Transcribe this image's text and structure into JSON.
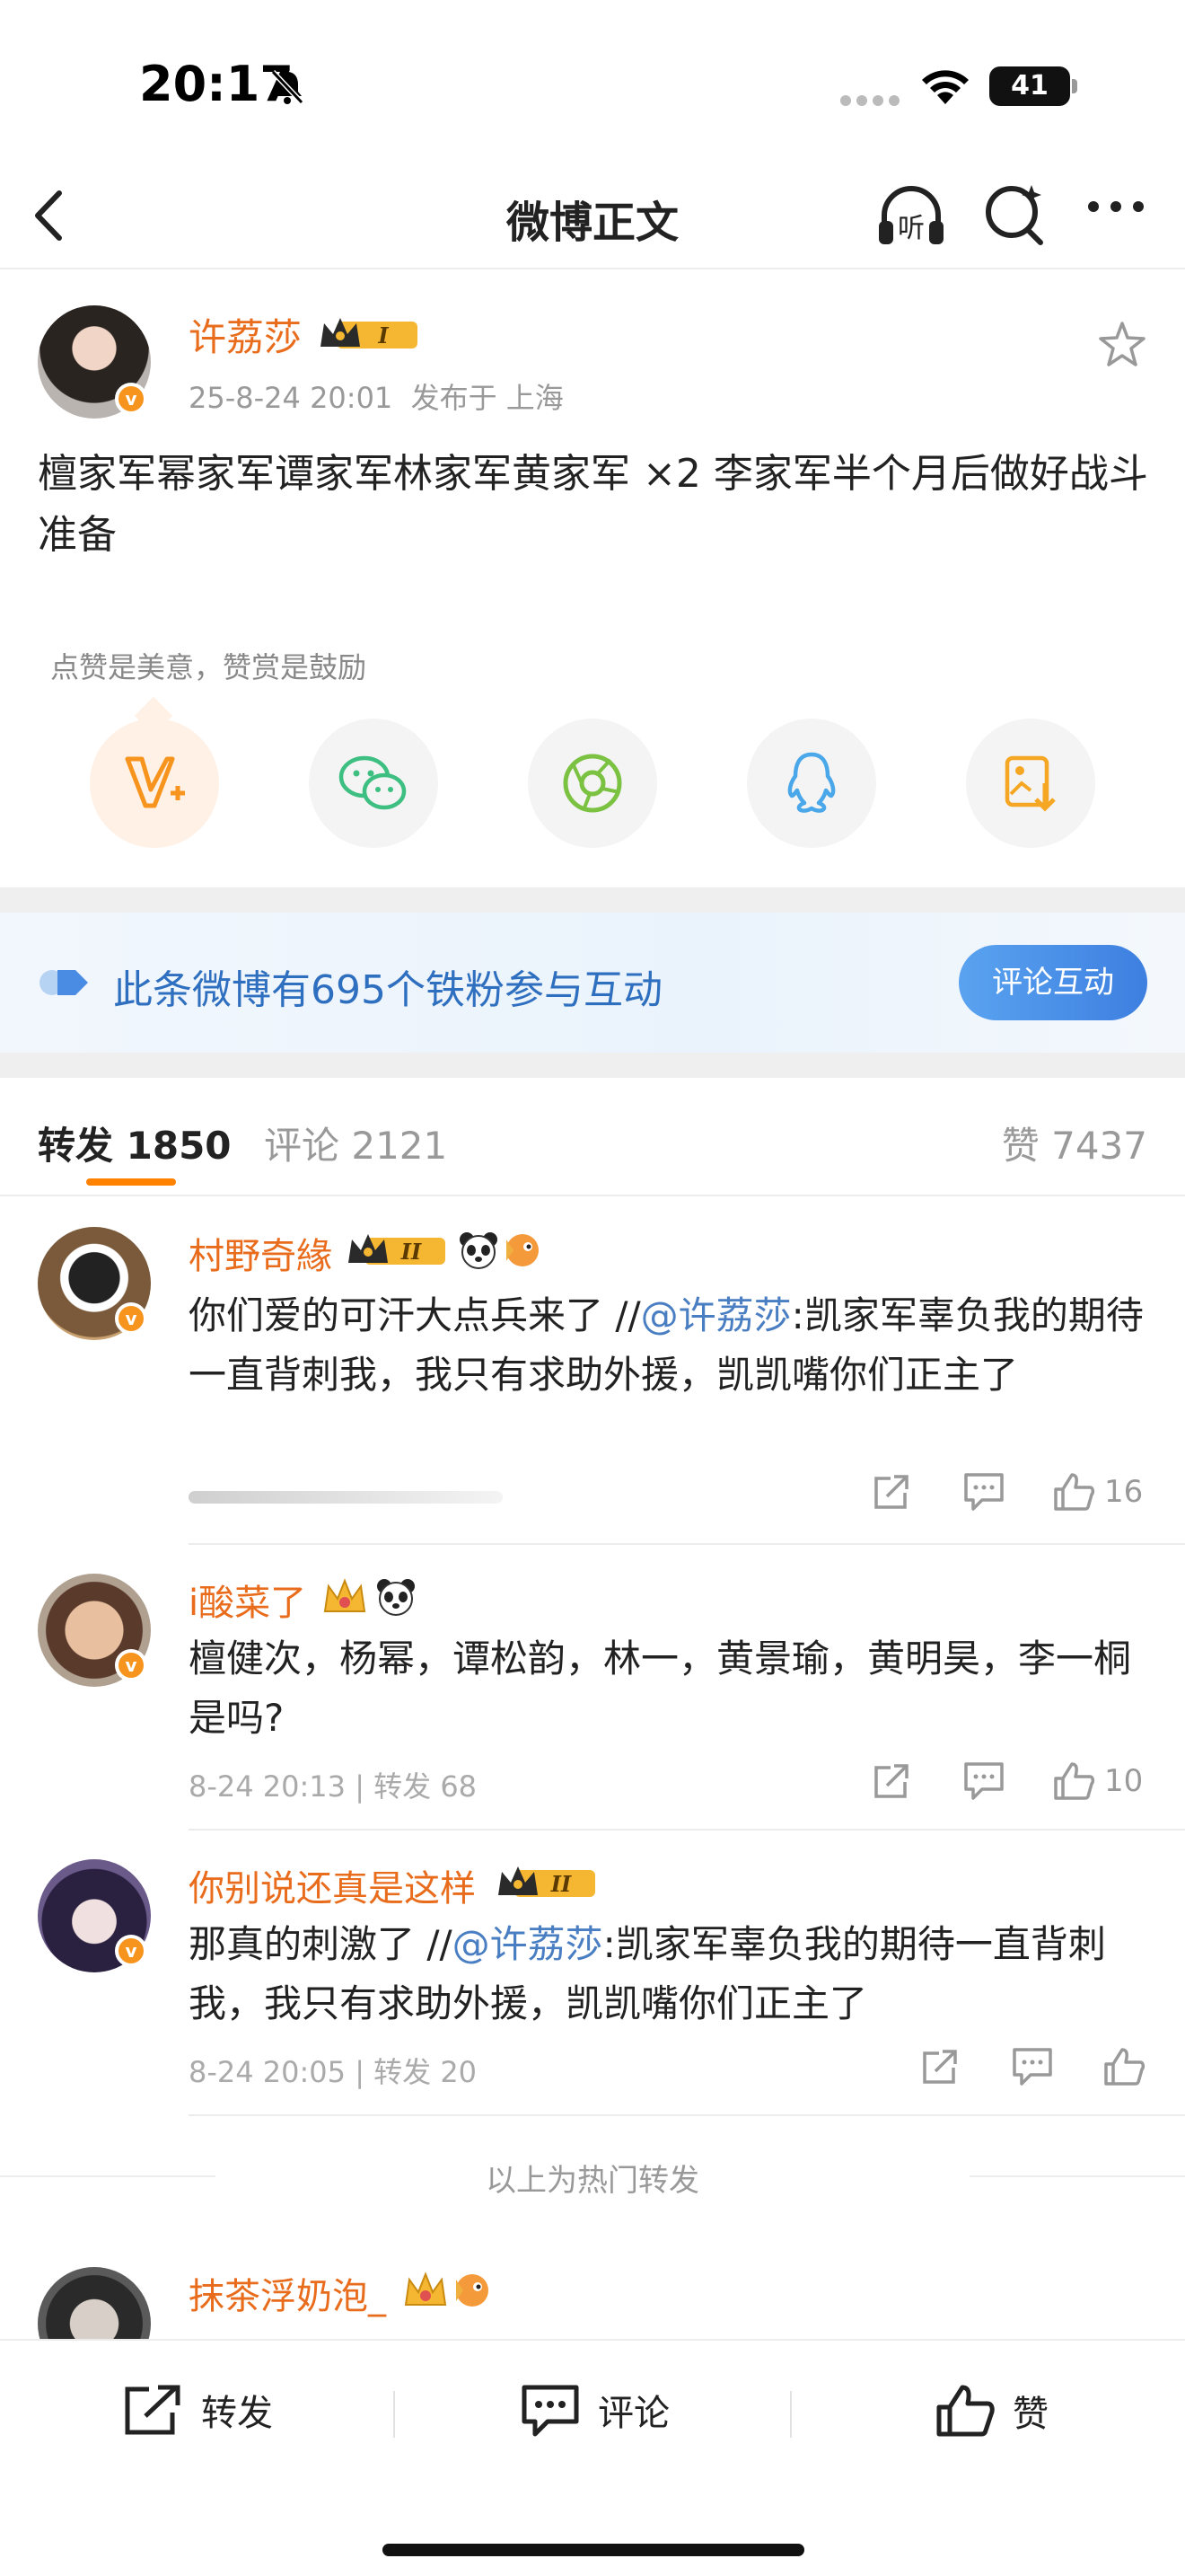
{
  "status_bar": {
    "time": "20:17",
    "battery": "41"
  },
  "nav": {
    "title": "微博正文",
    "back_icon": "chevron-left-icon",
    "listen_label": "听"
  },
  "post": {
    "author": "许荔莎",
    "level": "I",
    "date": "25-8-24 20:01",
    "location": "发布于 上海",
    "text": "檀家军幂家军谭家军林家军黄家军 ×2 李家军半个月后做好战斗准备",
    "reward_tip": "点赞是美意，赞赏是鼓励"
  },
  "share_targets": [
    "reward-v-icon",
    "wechat-icon",
    "moments-icon",
    "qq-icon",
    "save-image-icon"
  ],
  "fans_banner": {
    "text": "此条微博有695个铁粉参与互动",
    "button": "评论互动"
  },
  "tabs": {
    "repost": "转发 1850",
    "comment": "评论 2121",
    "like": "赞 7437"
  },
  "reposts": [
    {
      "name": "村野奇緣",
      "level": "II",
      "text_pre": "你们爱的可汗大点兵来了 //",
      "mention": "@许荔莎",
      "text_post": ":凯家军辜负我的期待一直背刺我，我只有求助外援，凯凯嘴你们正主了",
      "meta": "",
      "likes": "16"
    },
    {
      "name": "i酸菜了",
      "level": "",
      "text_pre": "檀健次，杨幂，谭松韵，林一，黄景瑜，黄明昊，李一桐是吗?",
      "mention": "",
      "text_post": "",
      "meta": "8-24 20:13 | 转发 68",
      "likes": "10"
    },
    {
      "name": "你别说还真是这样",
      "level": "II",
      "text_pre": "那真的刺激了 //",
      "mention": "@许荔莎",
      "text_post": ":凯家军辜负我的期待一直背刺我，我只有求助外援，凯凯嘴你们正主了",
      "meta": "8-24 20:05 | 转发 20",
      "likes": ""
    },
    {
      "name": "抹茶浮奶泡_",
      "level": "",
      "text_pre": "",
      "mention": "",
      "text_post": "",
      "meta": "",
      "likes": ""
    }
  ],
  "hot_end": "以上为热门转发",
  "bottom_bar": {
    "repost": "转发",
    "comment": "评论",
    "like": "赞"
  },
  "colors": {
    "accent": "#ff8200",
    "name": "#e86c1c",
    "link": "#4a7ec2",
    "button": "#3d7fe0"
  }
}
